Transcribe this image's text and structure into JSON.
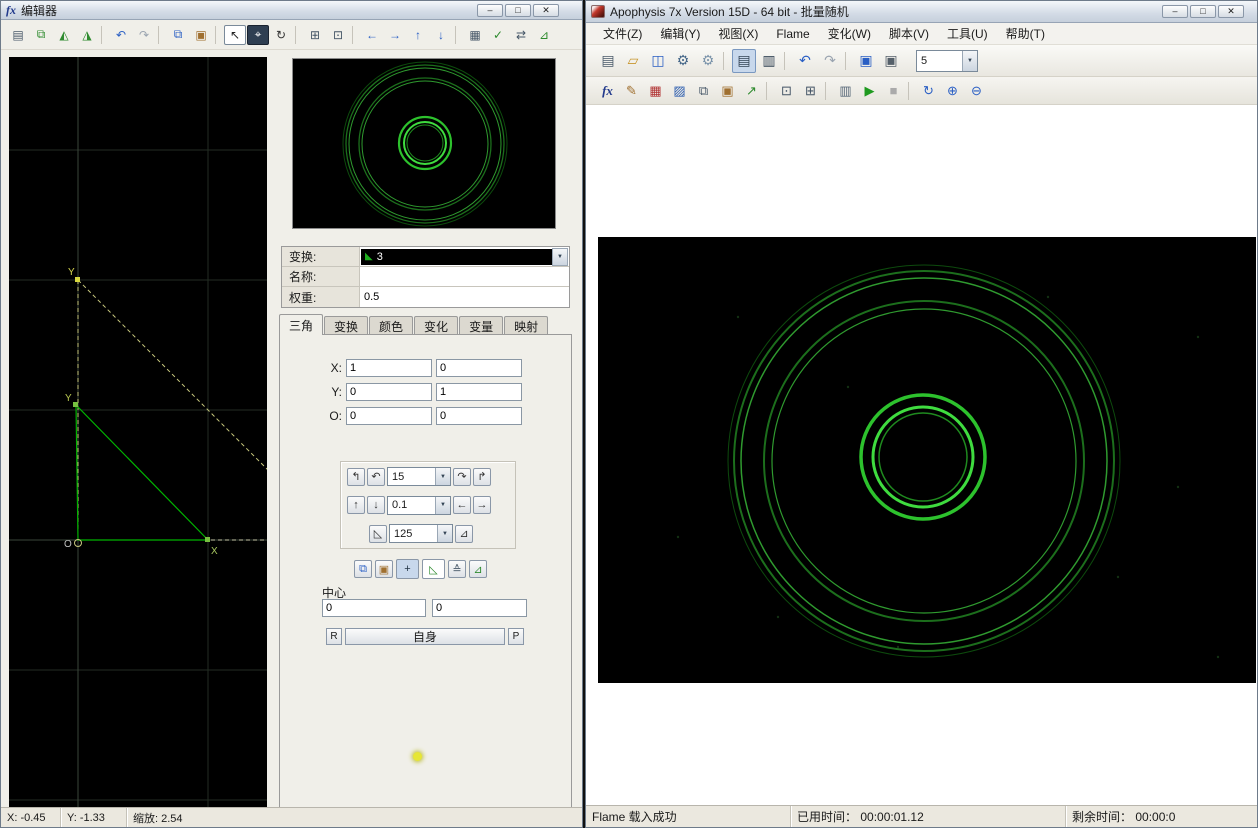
{
  "editor": {
    "icon_text": "fx",
    "title": "编辑器",
    "window_buttons": [
      {
        "name": "editor-minimize-button",
        "glyph": "–"
      },
      {
        "name": "editor-maximize-button",
        "glyph": "□"
      },
      {
        "name": "editor-close-button",
        "glyph": "✕"
      }
    ],
    "toolbar": [
      {
        "name": "new-flame-icon",
        "glyph": "▤",
        "color": "#4a5a6a"
      },
      {
        "name": "duplicate-transform-icon",
        "glyph": "⧉",
        "color": "#2e8b2e"
      },
      {
        "name": "add-transform-icon",
        "glyph": "◭",
        "color": "#2e8b2e"
      },
      {
        "name": "delete-transform-icon",
        "glyph": "◮",
        "color": "#2e8b2e"
      },
      {
        "type": "sep"
      },
      {
        "name": "undo-icon",
        "glyph": "↶",
        "color": "#2a5fc4"
      },
      {
        "name": "redo-icon",
        "glyph": "↷",
        "color": "#9aa4b0"
      },
      {
        "type": "sep"
      },
      {
        "name": "copy-icon",
        "glyph": "⧉",
        "color": "#2a5fc4"
      },
      {
        "name": "paste-icon",
        "glyph": "▣",
        "color": "#a07030"
      },
      {
        "type": "sep"
      },
      {
        "name": "select-tool-icon",
        "glyph": "↖",
        "color": "#222",
        "cls": "light"
      },
      {
        "name": "move-tool-icon",
        "glyph": "⌖",
        "color": "#ffffff",
        "cls": "dark"
      },
      {
        "name": "rotate-tool-icon",
        "glyph": "↻",
        "color": "#333"
      },
      {
        "type": "sep"
      },
      {
        "name": "world-pivot-icon",
        "glyph": "⊞",
        "color": "#445566"
      },
      {
        "name": "local-pivot-icon",
        "glyph": "⊡",
        "color": "#445566"
      },
      {
        "type": "sep"
      },
      {
        "name": "pan-left-icon",
        "glyph": "←",
        "color": "#2a5fc4"
      },
      {
        "name": "pan-right-icon",
        "glyph": "→",
        "color": "#2a5fc4"
      },
      {
        "name": "pan-up-icon",
        "glyph": "↑",
        "color": "#2a5fc4"
      },
      {
        "name": "pan-down-icon",
        "glyph": "↓",
        "color": "#2a5fc4"
      },
      {
        "type": "sep"
      },
      {
        "name": "grid-toggle-icon",
        "glyph": "▦",
        "color": "#445566"
      },
      {
        "name": "variation-preview-icon",
        "glyph": "✓",
        "color": "#2e8b2e"
      },
      {
        "name": "xaos-view-icon",
        "glyph": "⇄",
        "color": "#445566"
      },
      {
        "name": "post-transform-icon",
        "glyph": "⊿",
        "color": "#2e8b2e"
      }
    ],
    "transform_panel": {
      "transform_label": "变换:",
      "transform_value": "3",
      "name_label": "名称:",
      "name_value": "",
      "weight_label": "权重:",
      "weight_value": "0.5"
    },
    "tabs": [
      {
        "name": "tab-triangle",
        "label": "三角",
        "cls": "active"
      },
      {
        "name": "tab-transform",
        "label": "变换"
      },
      {
        "name": "tab-color",
        "label": "颜色"
      },
      {
        "name": "tab-variations",
        "label": "变化"
      },
      {
        "name": "tab-variables",
        "label": "变量"
      },
      {
        "name": "tab-mapping",
        "label": "映射"
      }
    ],
    "triangle_tab": {
      "x_label": "X:",
      "x1": "1",
      "x2": "0",
      "y_label": "Y:",
      "y1": "0",
      "y2": "1",
      "o_label": "O:",
      "o1": "0",
      "o2": "0",
      "center_label": "中心",
      "center_x": "0",
      "center_y": "0",
      "reset_label": "R",
      "self_label": "自身",
      "post_label": "P"
    },
    "rot_row1": [
      {
        "name": "rotate-left-90-icon",
        "glyph": "↰"
      },
      {
        "name": "rotate-left-icon",
        "glyph": "↶"
      },
      {
        "type": "combo",
        "name": "rotate-step-combo",
        "value": "15",
        "width": 64
      },
      {
        "name": "rotate-right-icon",
        "glyph": "↷"
      },
      {
        "name": "rotate-right-90-icon",
        "glyph": "↱"
      }
    ],
    "rot_row2": [
      {
        "name": "move-up-icon",
        "glyph": "↑"
      },
      {
        "name": "move-down-icon",
        "glyph": "↓"
      },
      {
        "type": "combo",
        "name": "move-step-combo",
        "value": "0.1",
        "width": 64
      },
      {
        "name": "move-left-icon",
        "glyph": "←"
      },
      {
        "name": "move-right-icon",
        "glyph": "→"
      }
    ],
    "rot_row3": [
      {
        "type": "spacer",
        "width": 20
      },
      {
        "name": "scale-down-icon",
        "glyph": "◺"
      },
      {
        "type": "combo",
        "name": "scale-step-combo",
        "value": "125",
        "width": 64
      },
      {
        "name": "scale-up-icon",
        "glyph": "⊿"
      }
    ],
    "mini_buttons": [
      {
        "name": "copy-coords-icon",
        "glyph": "⧉",
        "color": "#2a5fc4"
      },
      {
        "name": "paste-coords-icon",
        "glyph": "▣",
        "color": "#a07030"
      },
      {
        "name": "pivot-mode-icon",
        "glyph": "+",
        "cls": "pressed big",
        "color": "#223344"
      },
      {
        "name": "triangle-pick-icon",
        "glyph": "◺",
        "cls": "light big",
        "color": "#2e8b2e"
      },
      {
        "name": "weight-balance-icon",
        "glyph": "≙",
        "color": "#445566"
      },
      {
        "name": "axes-lock-icon",
        "glyph": "⊿",
        "color": "#2e8b2e"
      }
    ],
    "canvas_labels": {
      "top_y": "Y",
      "mid_y": "Y",
      "x": "X",
      "origin": "O"
    },
    "statusbar": {
      "x": "X: -0.45",
      "y": "Y: -1.33",
      "zoom": "缩放: 2.54"
    }
  },
  "main": {
    "title": "Apophysis 7x Version 15D - 64 bit - 批量随机",
    "window_buttons": [
      {
        "name": "main-minimize-button",
        "glyph": "–"
      },
      {
        "name": "main-maximize-button",
        "glyph": "□"
      },
      {
        "name": "main-close-button",
        "glyph": "✕"
      }
    ],
    "menu": [
      {
        "name": "menu-file",
        "label": "文件(Z)"
      },
      {
        "name": "menu-edit",
        "label": "编辑(Y)"
      },
      {
        "name": "menu-view",
        "label": "视图(X)"
      },
      {
        "name": "menu-flame",
        "label": "Flame"
      },
      {
        "name": "menu-variation",
        "label": "变化(W)"
      },
      {
        "name": "menu-script",
        "label": "脚本(V)"
      },
      {
        "name": "menu-tools",
        "label": "工具(U)"
      },
      {
        "name": "menu-help",
        "label": "帮助(T)"
      }
    ],
    "toolbar1": [
      {
        "name": "new-batch-icon",
        "glyph": "▤",
        "color": "#4a5a6a"
      },
      {
        "name": "open-icon",
        "glyph": "▱",
        "color": "#c8962e"
      },
      {
        "name": "save-icon",
        "glyph": "◫",
        "color": "#2a5fc4"
      },
      {
        "name": "render-icon",
        "glyph": "⚙",
        "color": "#446688"
      },
      {
        "name": "render-all-icon",
        "glyph": "⚙",
        "color": "#7a93aa"
      },
      {
        "type": "sep"
      },
      {
        "name": "flame-list-icon",
        "glyph": "▤",
        "color": "#334455",
        "cls": "pressed"
      },
      {
        "name": "sort-list-icon",
        "glyph": "▥",
        "color": "#334455"
      },
      {
        "type": "sep"
      },
      {
        "name": "undo-icon",
        "glyph": "↶",
        "color": "#2a5fc4"
      },
      {
        "name": "redo-icon",
        "glyph": "↷",
        "color": "#9aa4b0"
      },
      {
        "type": "sep"
      },
      {
        "name": "image-size-icon",
        "glyph": "▣",
        "color": "#2a5fc4"
      },
      {
        "name": "display-icon",
        "glyph": "▣",
        "color": "#55606a"
      },
      {
        "type": "combo",
        "name": "quality-combo",
        "value": "5",
        "width": 62
      }
    ],
    "toolbar2": [
      {
        "name": "editor-icon",
        "glyph": "fx",
        "cls": "fxtext",
        "color": "#223a8c"
      },
      {
        "name": "adjust-icon",
        "glyph": "✎",
        "color": "#a07030"
      },
      {
        "name": "gradient-icon",
        "glyph": "▦",
        "color": "#b03030"
      },
      {
        "name": "palette-icon",
        "glyph": "▨",
        "color": "#3060b0"
      },
      {
        "name": "copy-params-icon",
        "glyph": "⧉",
        "color": "#445566"
      },
      {
        "name": "paste-params-icon",
        "glyph": "▣",
        "color": "#a07030"
      },
      {
        "name": "export-icon",
        "glyph": "↗",
        "color": "#2e8b2e"
      },
      {
        "type": "sep"
      },
      {
        "name": "fullscreen-icon",
        "glyph": "⊡",
        "color": "#445566"
      },
      {
        "name": "tile-windows-icon",
        "glyph": "⊞",
        "color": "#445566"
      },
      {
        "type": "sep"
      },
      {
        "name": "messages-icon",
        "glyph": "▥",
        "color": "#556677"
      },
      {
        "name": "run-icon",
        "glyph": "▶",
        "color": "#1f9a1f"
      },
      {
        "name": "stop-icon",
        "glyph": "■",
        "color": "#aaaaaa"
      },
      {
        "type": "sep"
      },
      {
        "name": "refresh-icon",
        "glyph": "↻",
        "color": "#2a5fc4"
      },
      {
        "name": "zoom-in-icon",
        "glyph": "⊕",
        "color": "#2a5fc4"
      },
      {
        "name": "zoom-out-icon",
        "glyph": "⊖",
        "color": "#2a5fc4"
      }
    ],
    "statusbar": {
      "message": "Flame 载入成功",
      "elapsed_label": "已用时间：",
      "elapsed_value": "00:00:01.12",
      "remaining_label": "剩余时间：",
      "remaining_value": "00:00:0"
    }
  }
}
